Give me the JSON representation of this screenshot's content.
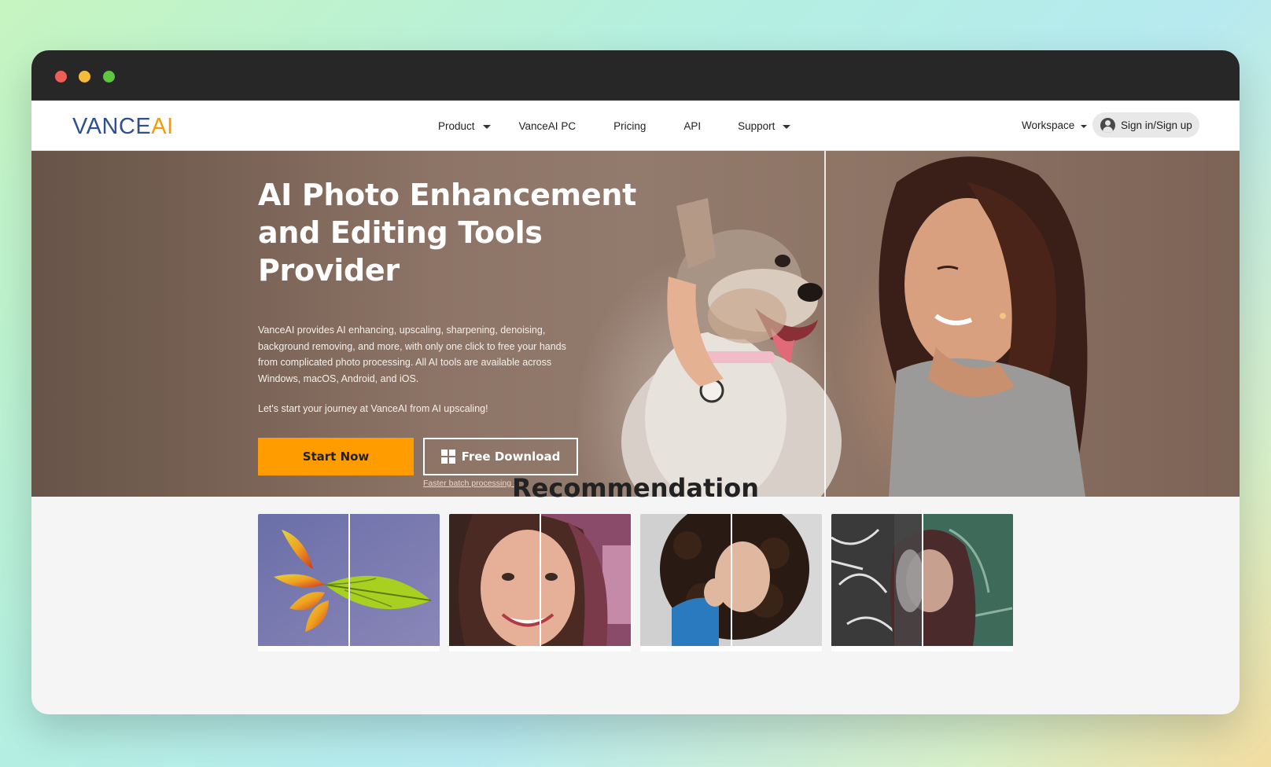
{
  "window": {
    "controls": [
      "close",
      "minimize",
      "maximize"
    ]
  },
  "nav": {
    "logo": {
      "part1": "VANCE",
      "part2": "AI"
    },
    "items": [
      {
        "label": "Product",
        "dropdown": true
      },
      {
        "label": "VanceAI PC",
        "dropdown": false
      },
      {
        "label": "Pricing",
        "dropdown": false
      },
      {
        "label": "API",
        "dropdown": false
      },
      {
        "label": "Support",
        "dropdown": true
      }
    ],
    "workspace": "Workspace",
    "signin": "Sign in/Sign up"
  },
  "hero": {
    "title": "AI Photo Enhancement and Editing Tools Provider",
    "description": "VanceAI provides AI enhancing, upscaling, sharpening, denoising, background removing, and more, with only one click to free your hands from complicated photo processing. All AI tools are available across Windows, macOS, Android, and iOS.",
    "subtext": "Let's start your journey at VanceAI from AI upscaling!",
    "start_button": "Start Now",
    "download_button": "Free Download",
    "batch_link": "Faster batch processing >"
  },
  "recommendation": {
    "title": "Recommendation",
    "cards": [
      {
        "name": "leaf"
      },
      {
        "name": "smiling-woman"
      },
      {
        "name": "curly-hair-woman"
      },
      {
        "name": "hooded-woman-colorize"
      }
    ]
  },
  "colors": {
    "accent": "#ff9c00",
    "logo_blue": "#2f4f8f",
    "logo_orange": "#f49a0d",
    "titlebar": "#272727"
  }
}
